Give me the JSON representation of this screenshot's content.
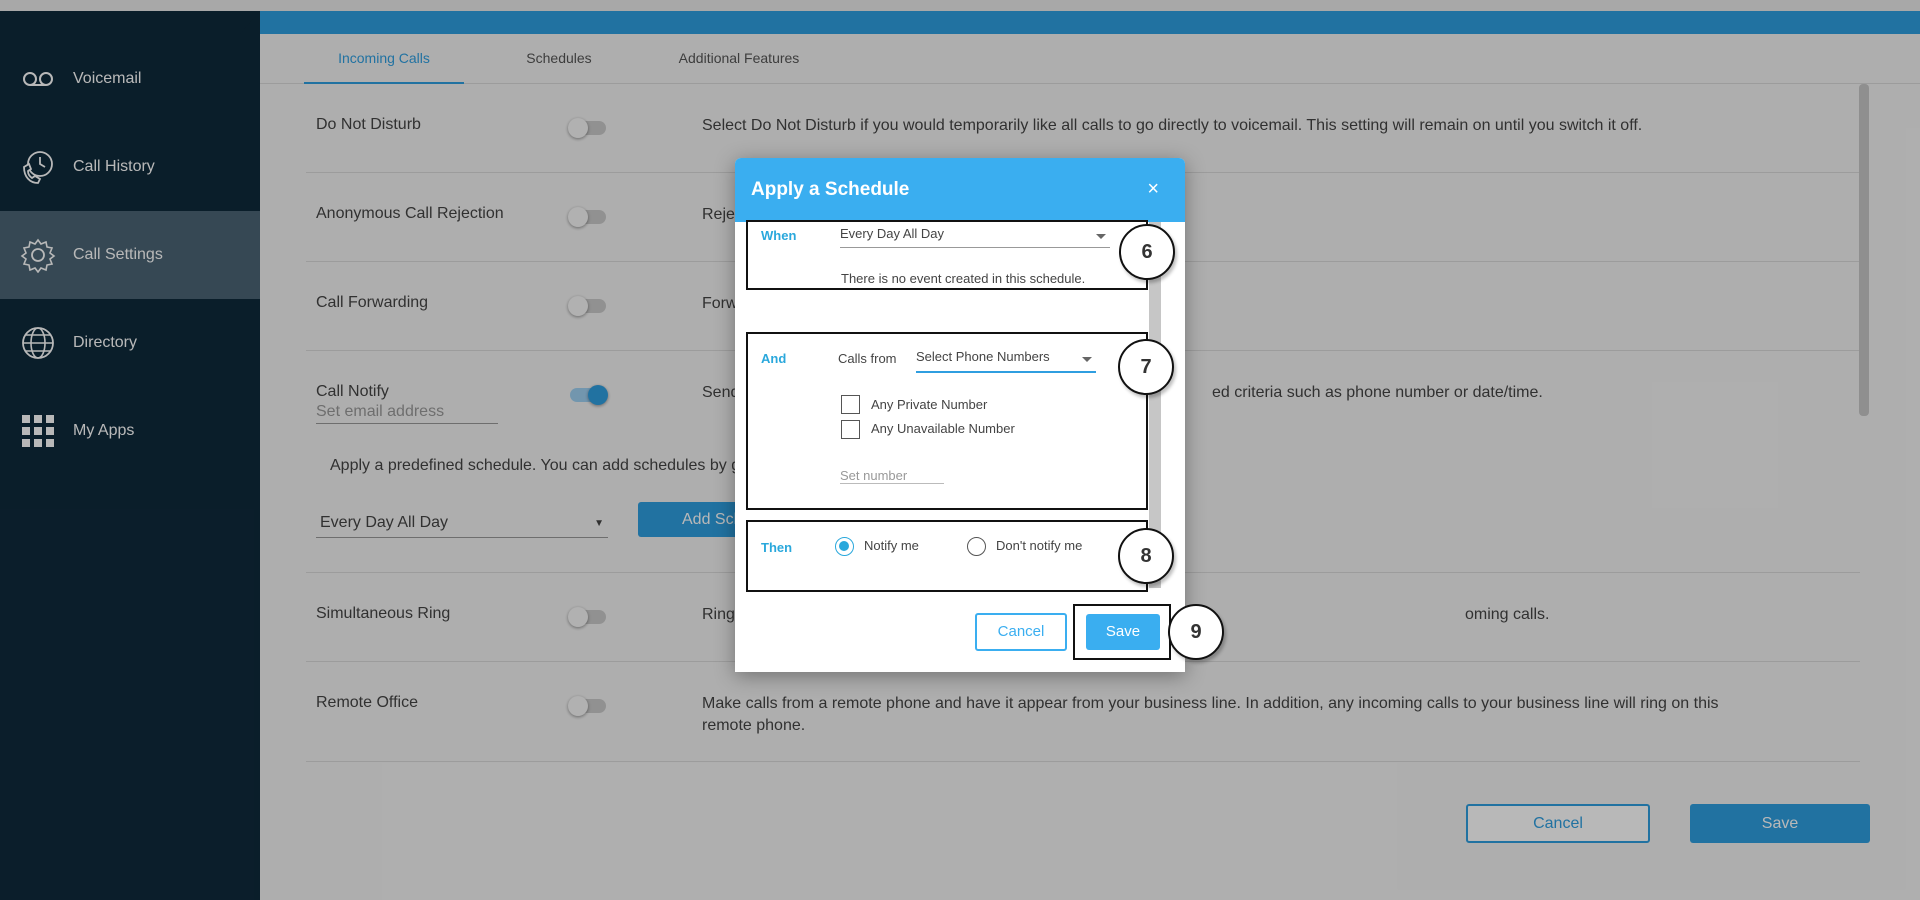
{
  "sidebar": {
    "items": [
      {
        "label": "Voicemail",
        "icon": "voicemail-icon",
        "active": false
      },
      {
        "label": "Call History",
        "icon": "call-history-icon",
        "active": false
      },
      {
        "label": "Call Settings",
        "icon": "gear-icon",
        "active": true
      },
      {
        "label": "Directory",
        "icon": "globe-icon",
        "active": false
      },
      {
        "label": "My Apps",
        "icon": "apps-grid-icon",
        "active": false
      }
    ]
  },
  "tabs": [
    {
      "label": "Incoming Calls",
      "active": true
    },
    {
      "label": "Schedules",
      "active": false
    },
    {
      "label": "Additional Features",
      "active": false
    }
  ],
  "settings": {
    "dnd": {
      "label": "Do Not Disturb",
      "enabled": false,
      "description": "Select Do Not Disturb if you would temporarily like all calls to go directly to voicemail. This setting will remain on until you switch it off."
    },
    "acr": {
      "label": "Anonymous Call Rejection",
      "enabled": false,
      "description": "Rejec"
    },
    "forwarding": {
      "label": "Call Forwarding",
      "enabled": false,
      "description": "Forw"
    },
    "notify": {
      "label": "Call Notify",
      "enabled": true,
      "description_start": "Send",
      "description_end": "ed criteria such as phone number or date/time.",
      "email_placeholder": "Set email address",
      "schedule_text": "Apply a predefined schedule. You can add schedules by g",
      "schedule_value": "Every Day All Day",
      "add_schedule_label": "Add Sch"
    },
    "simring": {
      "label": "Simultaneous Ring",
      "enabled": false,
      "description_start": "Ring",
      "description_end": "oming calls."
    },
    "remote": {
      "label": "Remote Office",
      "enabled": false,
      "description": "Make calls from a remote phone and have it appear from your business line. In addition, any incoming calls to your business line will ring on this remote phone."
    }
  },
  "footer": {
    "cancel": "Cancel",
    "save": "Save"
  },
  "modal": {
    "title": "Apply a Schedule",
    "close": "×",
    "when": {
      "label": "When",
      "value": "Every Day All Day",
      "note": "There is no event created in this schedule."
    },
    "and": {
      "label": "And",
      "calls_from": "Calls from",
      "select_value": "Select Phone Numbers",
      "private": "Any Private Number",
      "unavailable": "Any Unavailable Number",
      "number_placeholder": "Set number"
    },
    "then": {
      "label": "Then",
      "notify": "Notify me",
      "dont_notify": "Don't notify me"
    },
    "cancel": "Cancel",
    "save": "Save"
  },
  "annotations": [
    "6",
    "7",
    "8",
    "9"
  ]
}
